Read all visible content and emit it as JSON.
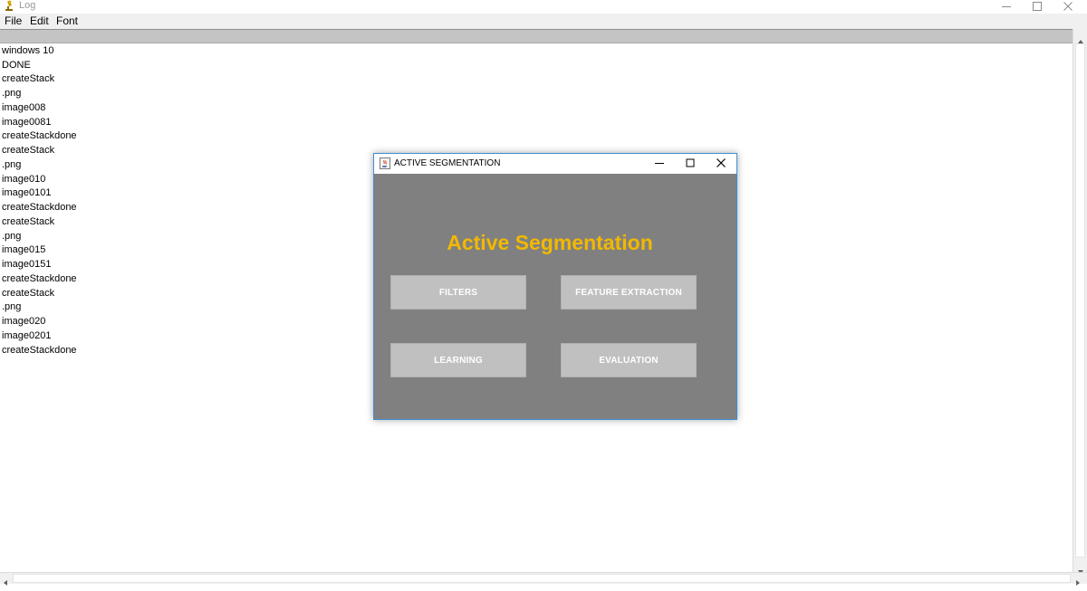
{
  "window": {
    "title": "Log",
    "minimize_glyph": "minimize-icon",
    "maximize_glyph": "maximize-icon",
    "close_glyph": "close-icon"
  },
  "menu": {
    "items": [
      "File",
      "Edit",
      "Font"
    ]
  },
  "log": {
    "lines": [
      "windows 10",
      "DONE",
      "createStack",
      ".png",
      "image008",
      "image0081",
      "createStackdone",
      "createStack",
      ".png",
      "image010",
      "image0101",
      "createStackdone",
      "createStack",
      ".png",
      "image015",
      "image0151",
      "createStackdone",
      "createStack",
      ".png",
      "image020",
      "image0201",
      "createStackdone"
    ]
  },
  "dialog": {
    "title": "ACTIVE SEGMENTATION",
    "heading": "Active Segmentation",
    "heading_color": "#f2b800",
    "buttons": {
      "filters": "FILTERS",
      "feature_extraction": "FEATURE EXTRACTION",
      "learning": "LEARNING",
      "evaluation": "EVALUATION"
    }
  },
  "colors": {
    "dialog_bg": "#808080",
    "button_bg": "#c0c0c0",
    "dialog_border": "#3d8ed8"
  }
}
